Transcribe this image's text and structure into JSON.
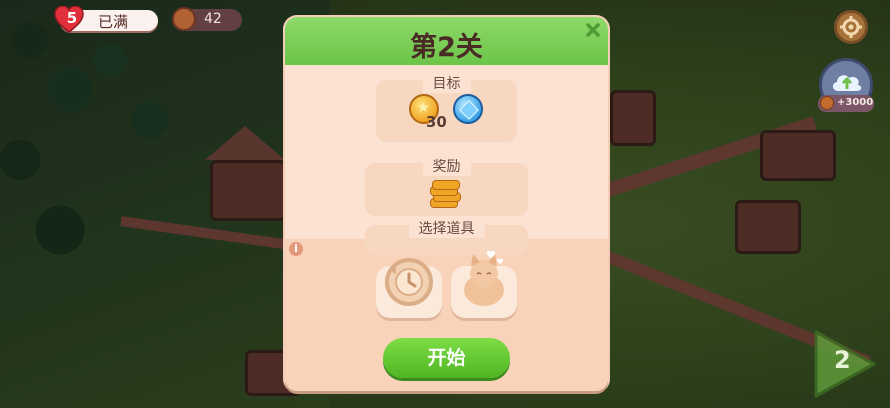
{
  "hud": {
    "lives": {
      "count": "5",
      "status": "已满"
    },
    "coins": "42",
    "bonus": "+3000"
  },
  "dialog": {
    "title": "第2关",
    "goal": {
      "label": "目标",
      "coin_count": "30"
    },
    "reward": {
      "label": "奖励"
    },
    "tools": {
      "label": "选择道具"
    },
    "start_button": "开始"
  },
  "next_level": "2",
  "colors": {
    "header_green": "#6cc548",
    "start_green": "#4fb523",
    "dialog_bg": "#fbe2d3"
  },
  "icons": [
    "heart-icon",
    "coin-icon",
    "gear-icon",
    "cloud-upload-icon",
    "close-icon",
    "star-coin-icon",
    "blue-gem-icon",
    "coin-stack-icon",
    "info-icon",
    "timer-booster-icon",
    "cat-booster-icon",
    "next-arrow-icon"
  ]
}
